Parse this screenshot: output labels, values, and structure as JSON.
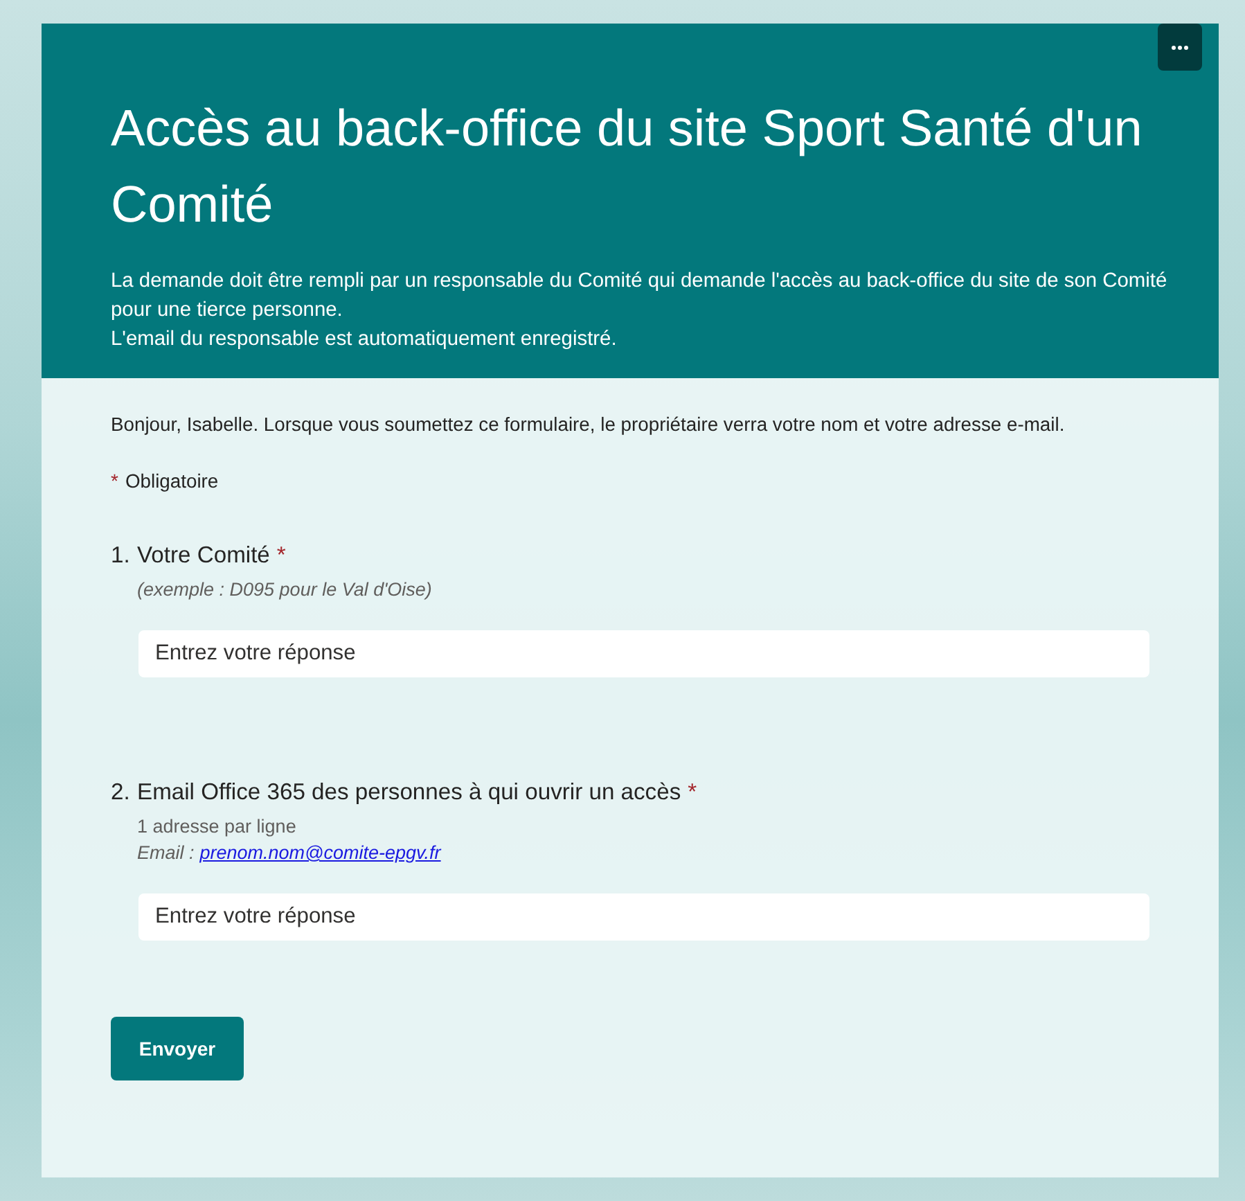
{
  "header": {
    "title": "Accès au back-office du site Sport Santé d'un Comité",
    "description": [
      "La demande doit être rempli par un responsable du Comité qui demande l'accès au back-office du site de son Comité pour une tierce personne.",
      "L'email du responsable est automatiquement enregistré."
    ]
  },
  "notice": "Bonjour, Isabelle. Lorsque vous soumettez ce formulaire, le propriétaire verra votre nom et votre adresse e-mail.",
  "required_legend": {
    "mark": "*",
    "label": "Obligatoire"
  },
  "questions": [
    {
      "number": "1.",
      "title": "Votre Comité",
      "required_mark": "*",
      "hints": [
        {
          "kind": "italic",
          "text": "(exemple : D095 pour le Val d'Oise)"
        }
      ],
      "placeholder": "Entrez votre réponse"
    },
    {
      "number": "2.",
      "title": "Email Office 365 des personnes à qui ouvrir un accès",
      "required_mark": "*",
      "hints": [
        {
          "kind": "plain",
          "text": "1 adresse par ligne"
        },
        {
          "kind": "example",
          "label": "Email :",
          "link": "prenom.nom@comite-epgv.fr"
        }
      ],
      "placeholder": "Entrez votre réponse"
    }
  ],
  "submit_button": "Envoyer"
}
